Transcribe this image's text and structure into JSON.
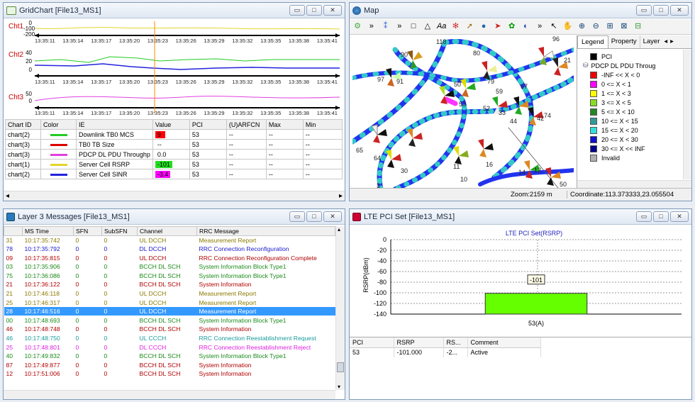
{
  "colors": {
    "accent": "#3399ff",
    "title_bar": "#dfe8f3",
    "chart_line_yellow": "#e3d52a",
    "chart_line_green": "#22cc22",
    "chart_line_blue": "#2222dd",
    "chart_line_magenta": "#e040e0",
    "cursor_orange": "#ff8800",
    "bar_green": "#66ff00"
  },
  "gridchart": {
    "title": "GridChart [File13_MS1]",
    "charts": [
      {
        "label": "Cht1",
        "ticks": [
          "0",
          "-100",
          "-200"
        ]
      },
      {
        "label": "Cht2",
        "ticks": [
          "40",
          "20",
          "0"
        ]
      },
      {
        "label": "Cht3",
        "ticks": [
          "50",
          "0"
        ]
      }
    ],
    "times": [
      "13:35:11",
      "13:35:14",
      "13:35:17",
      "13:35:20",
      "13:35:23",
      "13:35:26",
      "13:35:29",
      "13:35:32",
      "13:35:35",
      "13:35:38",
      "13:35:41"
    ],
    "table": {
      "headers": [
        "Chart ID",
        "Color",
        "IE",
        "Value",
        "PCI",
        "(U)ARFCN",
        "Max",
        "Min"
      ],
      "rows": [
        {
          "id": "chart(2)",
          "color": "#22cc22",
          "ie": "Downlink TB0 MCS",
          "value": "9",
          "vcolor": "#ff0000",
          "pci": "53",
          "arfcn": "--",
          "max": "--",
          "min": "--"
        },
        {
          "id": "chart(3)",
          "color": "#dd0000",
          "ie": "TB0 TB Size",
          "value": "--",
          "vcolor": "",
          "pci": "53",
          "arfcn": "--",
          "max": "--",
          "min": "--"
        },
        {
          "id": "chart(3)",
          "color": "#e040e0",
          "ie": "PDCP DL PDU Throughp",
          "value": "0.0",
          "vcolor": "",
          "pci": "53",
          "arfcn": "--",
          "max": "--",
          "min": "--"
        },
        {
          "id": "chart(1)",
          "color": "#e3d52a",
          "ie": "Server Cell RSRP",
          "value": "-101",
          "vcolor": "#22dd22",
          "pci": "53",
          "arfcn": "--",
          "max": "--",
          "min": "--"
        },
        {
          "id": "chart(2)",
          "color": "#2222dd",
          "ie": "Server Cell SINR",
          "value": "-3.4",
          "vcolor": "#ff00ff",
          "pci": "53",
          "arfcn": "--",
          "max": "--",
          "min": "--"
        }
      ]
    }
  },
  "map": {
    "title": "Map",
    "zoom": "Zoom:2159 m",
    "coordinate": "Coordinate:113.373333,23.055504",
    "tabs": [
      "Legend",
      "Property",
      "Layer"
    ],
    "legend": {
      "pci_label": "PCI",
      "group_label": "PDCP DL PDU Throug",
      "items": [
        {
          "color": "#ee0000",
          "label": "-INF << X < 0"
        },
        {
          "color": "#ff00ff",
          "label": "0 <= X < 1"
        },
        {
          "color": "#ffff00",
          "label": "1 <= X < 3"
        },
        {
          "color": "#88dd22",
          "label": "3 <= X < 5"
        },
        {
          "color": "#228822",
          "label": "5 <= X < 10"
        },
        {
          "color": "#339999",
          "label": "10 <= X < 15"
        },
        {
          "color": "#33dddd",
          "label": "15 <= X < 20"
        },
        {
          "color": "#1111cc",
          "label": "20 <= X < 30"
        },
        {
          "color": "#000088",
          "label": "30 <= X << INF"
        },
        {
          "color": "#b0b0b0",
          "label": "Invalid"
        }
      ]
    },
    "cells": [
      "118",
      "80",
      "90",
      "91",
      "97",
      "79",
      "50",
      "59",
      "57",
      "96",
      "52",
      "33",
      "42",
      "74",
      "53",
      "44",
      "65",
      "64",
      "30",
      "11",
      "16",
      "14",
      "12",
      "50",
      "10",
      "21",
      "3"
    ]
  },
  "l3": {
    "title": "Layer 3 Messages [File13_MS1]",
    "headers": [
      "",
      "MS Time",
      "SFN",
      "SubSFN",
      "Channel",
      "RRC Message"
    ],
    "rows": [
      {
        "n": "31",
        "t": "10:17:35:742",
        "sfn": "0",
        "sub": "0",
        "ch": "UL DCCH",
        "msg": "Measurement Report",
        "c": "#8a7a00"
      },
      {
        "n": "78",
        "t": "10:17:35:792",
        "sfn": "0",
        "sub": "0",
        "ch": "DL DCCH",
        "msg": "RRC Connection Reconfiguration",
        "c": "#1a1acc"
      },
      {
        "n": "09",
        "t": "10:17:35:815",
        "sfn": "0",
        "sub": "0",
        "ch": "UL DCCH",
        "msg": "RRC Connection Reconfiguration Complete",
        "c": "#b00000"
      },
      {
        "n": "03",
        "t": "10:17:35:906",
        "sfn": "0",
        "sub": "0",
        "ch": "BCCH DL SCH",
        "msg": "System Information Block Type1",
        "c": "#1a8a1a"
      },
      {
        "n": "75",
        "t": "10:17:36:086",
        "sfn": "0",
        "sub": "0",
        "ch": "BCCH DL SCH",
        "msg": "System Information Block Type1",
        "c": "#1a8a1a"
      },
      {
        "n": "21",
        "t": "10:17:36:122",
        "sfn": "0",
        "sub": "0",
        "ch": "BCCH DL SCH",
        "msg": "System Information",
        "c": "#b00000"
      },
      {
        "n": "21",
        "t": "10:17:46:118",
        "sfn": "0",
        "sub": "0",
        "ch": "UL DCCH",
        "msg": "Measurement Report",
        "c": "#8a7a00"
      },
      {
        "n": "25",
        "t": "10:17:46:317",
        "sfn": "0",
        "sub": "0",
        "ch": "UL DCCH",
        "msg": "Measurement Report",
        "c": "#8a7a00"
      },
      {
        "n": "28",
        "t": "10:17:46:516",
        "sfn": "0",
        "sub": "0",
        "ch": "UL DCCH",
        "msg": "Measurement Report",
        "c": "#ffffff",
        "sel": true
      },
      {
        "n": "00",
        "t": "10:17:48:693",
        "sfn": "0",
        "sub": "0",
        "ch": "BCCH DL SCH",
        "msg": "System Information Block Type1",
        "c": "#1a8a1a"
      },
      {
        "n": "46",
        "t": "10:17:48:748",
        "sfn": "0",
        "sub": "0",
        "ch": "BCCH DL SCH",
        "msg": "System Information",
        "c": "#b00000"
      },
      {
        "n": "46",
        "t": "10:17:48:750",
        "sfn": "0",
        "sub": "0",
        "ch": "UL CCCH",
        "msg": "RRC Connection Reestablishment Request",
        "c": "#1a9a9a"
      },
      {
        "n": "25",
        "t": "10:17:48:801",
        "sfn": "0",
        "sub": "0",
        "ch": "DL CCCH",
        "msg": "RRC Connection Reestablishment Reject",
        "c": "#e020e0"
      },
      {
        "n": "40",
        "t": "10:17:49:832",
        "sfn": "0",
        "sub": "0",
        "ch": "BCCH DL SCH",
        "msg": "System Information Block Type1",
        "c": "#1a8a1a"
      },
      {
        "n": "87",
        "t": "10:17:49:877",
        "sfn": "0",
        "sub": "0",
        "ch": "BCCH DL SCH",
        "msg": "System Information",
        "c": "#b00000"
      },
      {
        "n": "12",
        "t": "10:17:51:006",
        "sfn": "0",
        "sub": "0",
        "ch": "BCCH DL SCH",
        "msg": "System Information",
        "c": "#b00000"
      }
    ]
  },
  "pciset": {
    "title": "LTE PCI Set [File13_MS1]",
    "headers": [
      "PCI",
      "RSRP",
      "RS...",
      "Comment"
    ],
    "rows": [
      {
        "pci": "53",
        "rsrp": "-101.000",
        "rs": "-2...",
        "comment": "Active"
      }
    ]
  },
  "chart_data": {
    "type": "bar",
    "title": "LTE PCI Set(RSRP)",
    "xlabel": "",
    "ylabel": "RSRP(dBm)",
    "categories": [
      "53(A)"
    ],
    "values": [
      -101
    ],
    "ylim": [
      -140,
      0
    ],
    "yticks": [
      0,
      -20,
      -40,
      -60,
      -80,
      -100,
      -120,
      -140
    ],
    "data_labels": [
      "-101"
    ],
    "grid": true
  }
}
